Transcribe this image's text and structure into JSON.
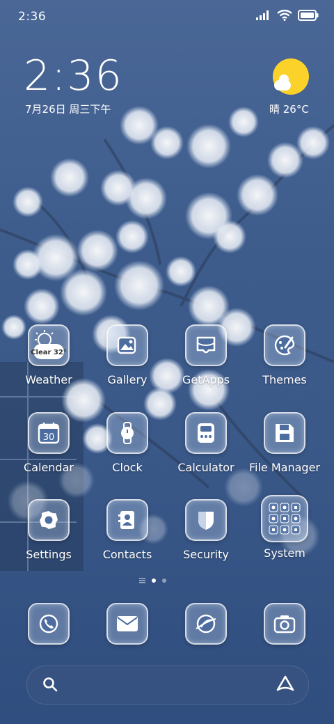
{
  "status_bar": {
    "time": "2:36",
    "icons": [
      "signal-icon",
      "wifi-icon",
      "battery-icon"
    ]
  },
  "clock_widget": {
    "time": "2:36",
    "date": "7月26日 周三下午"
  },
  "weather_widget": {
    "temp": "晴 26°C",
    "icon": "sun-cloud-icon"
  },
  "apps": [
    {
      "label": "Weather",
      "icon": "weather-icon",
      "badge": "Clear 32°"
    },
    {
      "label": "Gallery",
      "icon": "gallery-icon"
    },
    {
      "label": "GetApps",
      "icon": "getapps-icon"
    },
    {
      "label": "Themes",
      "icon": "themes-icon"
    },
    {
      "label": "Calendar",
      "icon": "calendar-icon",
      "badge": "30"
    },
    {
      "label": "Clock",
      "icon": "clock-icon"
    },
    {
      "label": "Calculator",
      "icon": "calculator-icon"
    },
    {
      "label": "File Manager",
      "icon": "file-manager-icon"
    },
    {
      "label": "Settings",
      "icon": "settings-icon"
    },
    {
      "label": "Contacts",
      "icon": "contacts-icon"
    },
    {
      "label": "Security",
      "icon": "security-icon"
    },
    {
      "label": "System",
      "icon": "folder-icon"
    }
  ],
  "page_indicator": {
    "pages": 2,
    "current": 1
  },
  "dock": [
    {
      "icon": "phone-icon"
    },
    {
      "icon": "messages-icon"
    },
    {
      "icon": "browser-icon"
    },
    {
      "icon": "camera-icon"
    }
  ],
  "search_bar": {
    "left_icon": "search-icon",
    "right_icon": "assistant-icon"
  },
  "colors": {
    "background": "#3d5c8c",
    "sun": "#fbd22a",
    "icon_fill": "#4d6da0"
  }
}
